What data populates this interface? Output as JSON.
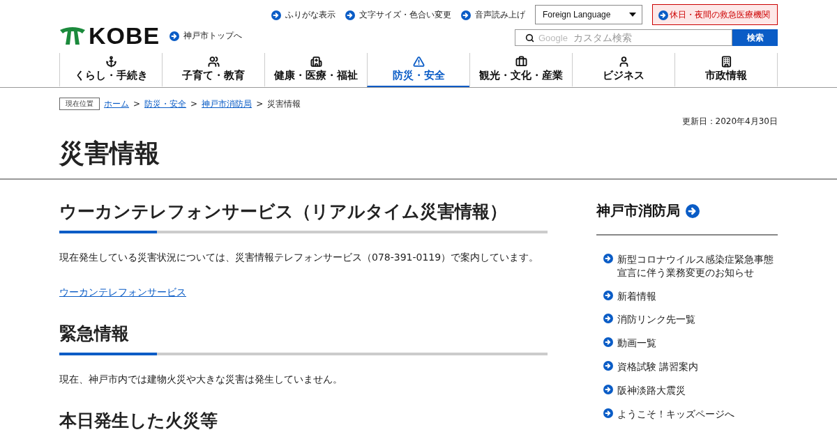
{
  "header": {
    "logo": "KOBE",
    "top_link": "神戸市トップへ",
    "utility_links": [
      "ふりがな表示",
      "文字サイズ・色合い変更",
      "音声読み上げ"
    ],
    "language_select": "Foreign Language",
    "emergency_button": "休日・夜間の救急医療機関",
    "search": {
      "brand": "Google",
      "placeholder": "カスタム検索",
      "button": "検索"
    }
  },
  "nav": [
    {
      "label": "くらし・手続き",
      "selected": false
    },
    {
      "label": "子育て・教育",
      "selected": false
    },
    {
      "label": "健康・医療・福祉",
      "selected": false
    },
    {
      "label": "防災・安全",
      "selected": true
    },
    {
      "label": "観光・文化・産業",
      "selected": false
    },
    {
      "label": "ビジネス",
      "selected": false
    },
    {
      "label": "市政情報",
      "selected": false
    }
  ],
  "breadcrumb": {
    "label": "現在位置",
    "separator": ">",
    "items": [
      {
        "text": "ホーム",
        "link": true
      },
      {
        "text": "防災・安全",
        "link": true
      },
      {
        "text": "神戸市消防局",
        "link": true
      },
      {
        "text": "災害情報",
        "link": false
      }
    ]
  },
  "updated": "更新日：2020年4月30日",
  "title": "災害情報",
  "sections": [
    {
      "heading": "ウーカンテレフォンサービス（リアルタイム災害情報）",
      "blocks": [
        {
          "kind": "text",
          "text": "現在発生している災害状況については、災害情報テレフォンサービス（078-391-0119）で案内しています。"
        },
        {
          "kind": "link",
          "text": "ウーカンテレフォンサービス"
        }
      ]
    },
    {
      "heading": "緊急情報",
      "blocks": [
        {
          "kind": "text",
          "text": "現在、神戸市内では建物火災や大きな災害は発生していません。"
        }
      ]
    },
    {
      "heading": "本日発生した火災等"
    }
  ],
  "sidebar": {
    "title": "神戸市消防局",
    "items": [
      "新型コロナウイルス感染症緊急事態宣言に伴う業務変更のお知らせ",
      "新着情報",
      "消防リンク先一覧",
      "動画一覧",
      "資格試験 講習案内",
      "阪神淡路大震災",
      "ようこそ！キッズページへ"
    ]
  }
}
